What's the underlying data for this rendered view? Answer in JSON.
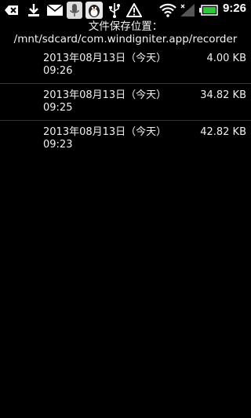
{
  "status_bar": {
    "time": "9:26",
    "icons": [
      "back-icon",
      "download-icon",
      "mail-icon",
      "mic-app-icon",
      "penguin-app-icon",
      "usb-icon",
      "warning-icon",
      "wifi-icon",
      "signal-icon",
      "battery-icon"
    ]
  },
  "header": {
    "line1": "文件保存位置：",
    "line2": "/mnt/sdcard/com.windigniter.app/recorder"
  },
  "recordings": [
    {
      "date": "2013年08月13日（今天）",
      "time": "09:26",
      "size": "4.00 KB"
    },
    {
      "date": "2013年08月13日（今天）",
      "time": "09:25",
      "size": "34.82 KB"
    },
    {
      "date": "2013年08月13日（今天）",
      "time": "09:23",
      "size": "42.82 KB"
    }
  ]
}
